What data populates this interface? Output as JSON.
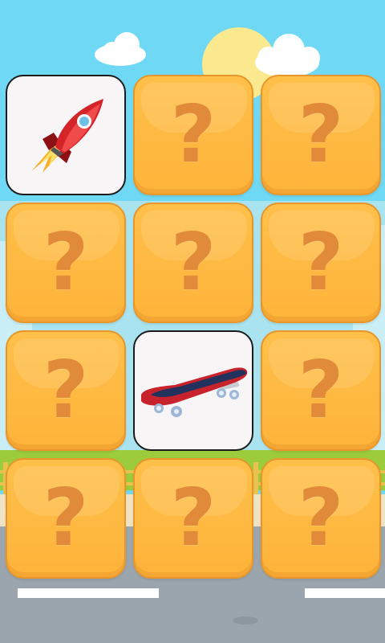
{
  "game": {
    "hidden_symbol": "?",
    "cards": [
      {
        "state": "revealed",
        "content_icon": "rocket-icon"
      },
      {
        "state": "hidden"
      },
      {
        "state": "hidden"
      },
      {
        "state": "hidden"
      },
      {
        "state": "hidden"
      },
      {
        "state": "hidden"
      },
      {
        "state": "hidden"
      },
      {
        "state": "revealed",
        "content_icon": "skateboard-icon"
      },
      {
        "state": "hidden"
      },
      {
        "state": "hidden"
      },
      {
        "state": "hidden"
      },
      {
        "state": "hidden"
      }
    ]
  },
  "colors": {
    "sky": "#6fd8f4",
    "card_back": "#fdb73e",
    "question_mark": "#e08a3a",
    "card_face": "#f7f5f6",
    "road": "#9aa5ad",
    "grass": "#9ccc3c"
  }
}
